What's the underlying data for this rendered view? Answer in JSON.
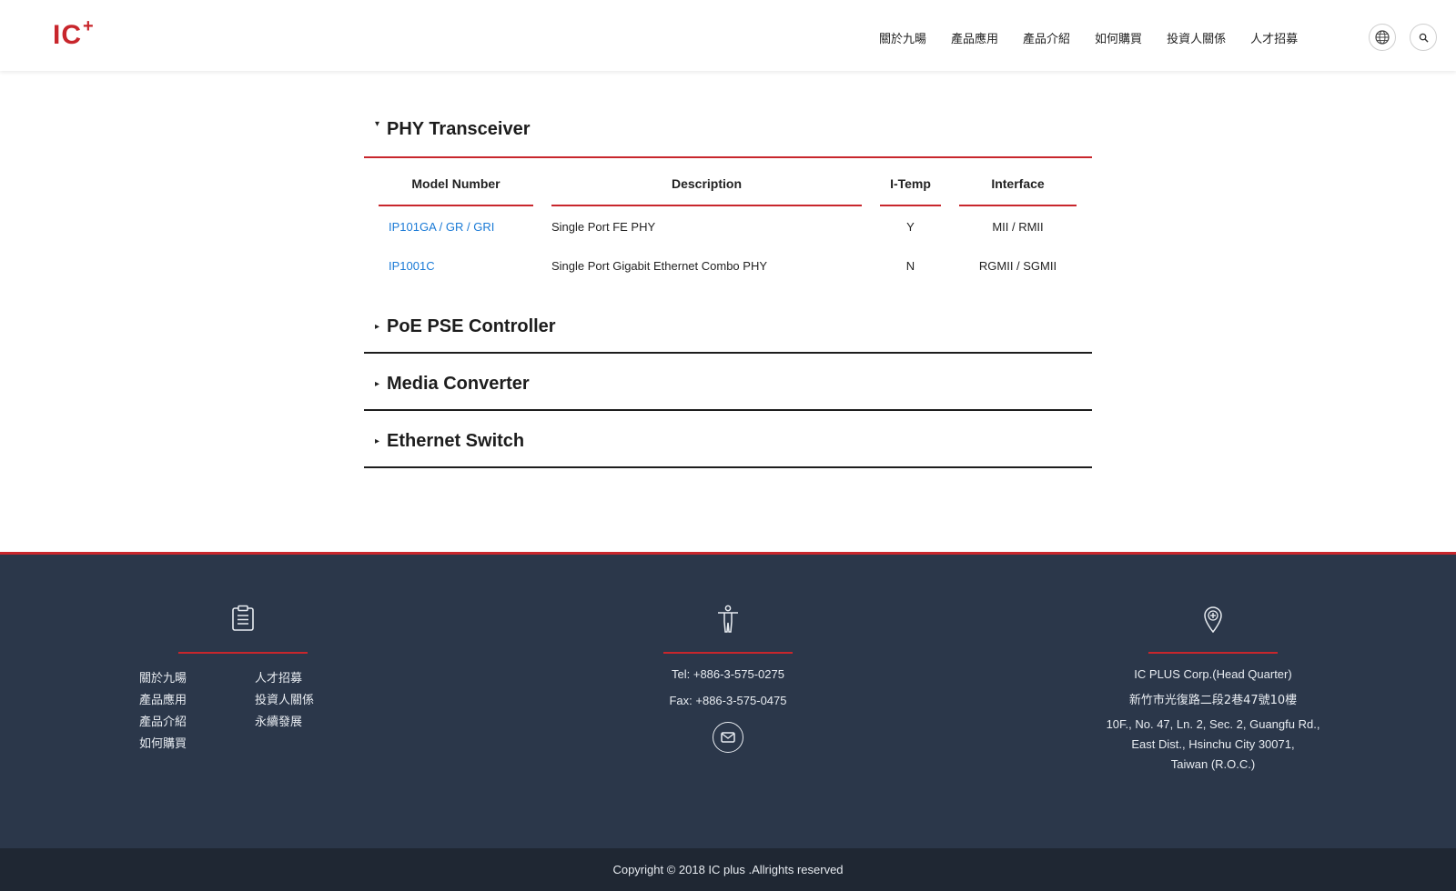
{
  "header": {
    "logo_text": "IC",
    "logo_plus": "+",
    "nav": [
      "關於九暘",
      "產品應用",
      "產品介紹",
      "如何購買",
      "投資人關係",
      "人才招募"
    ]
  },
  "sections": {
    "phy": {
      "caret": "▾",
      "title": "PHY Transceiver",
      "columns": [
        "Model Number",
        "Description",
        "I-Temp",
        "Interface"
      ],
      "rows": [
        {
          "model": "IP101GA / GR / GRI",
          "description": "Single Port FE PHY",
          "itemp": "Y",
          "interface": "MII / RMII"
        },
        {
          "model": "IP1001C",
          "description": "Single Port Gigabit Ethernet Combo PHY",
          "itemp": "N",
          "interface": "RGMII / SGMII"
        }
      ]
    },
    "poe": {
      "caret": "▸",
      "title": "PoE PSE Controller"
    },
    "media": {
      "caret": "▸",
      "title": "Media Converter"
    },
    "switch": {
      "caret": "▸",
      "title": "Ethernet Switch"
    }
  },
  "footer": {
    "links_col1": [
      "關於九暘",
      "產品應用",
      "產品介紹",
      "如何購買"
    ],
    "links_col2": [
      "人才招募",
      "投資人關係",
      "永續發展"
    ],
    "tel": "Tel: +886-3-575-0275",
    "fax": "Fax: +886-3-575-0475",
    "company": "IC PLUS Corp.(Head Quarter)",
    "address_zh": "新竹市光復路二段2巷47號10樓",
    "address_en_1": "10F., No. 47, Ln. 2, Sec. 2, Guangfu Rd.,",
    "address_en_2": "East Dist., Hsinchu City 30071,",
    "address_en_3": "Taiwan (R.O.C.)",
    "copyright": "Copyright © 2018 IC plus .Allrights reserved"
  },
  "colors": {
    "accent": "#c8262c",
    "link": "#1a7ad6",
    "footer_bg": "#2b374a",
    "copyright_bg": "#1f2733"
  },
  "icons": [
    "globe-icon",
    "search-icon",
    "clipboard-icon",
    "person-icon",
    "location-pin-icon",
    "mail-icon"
  ]
}
